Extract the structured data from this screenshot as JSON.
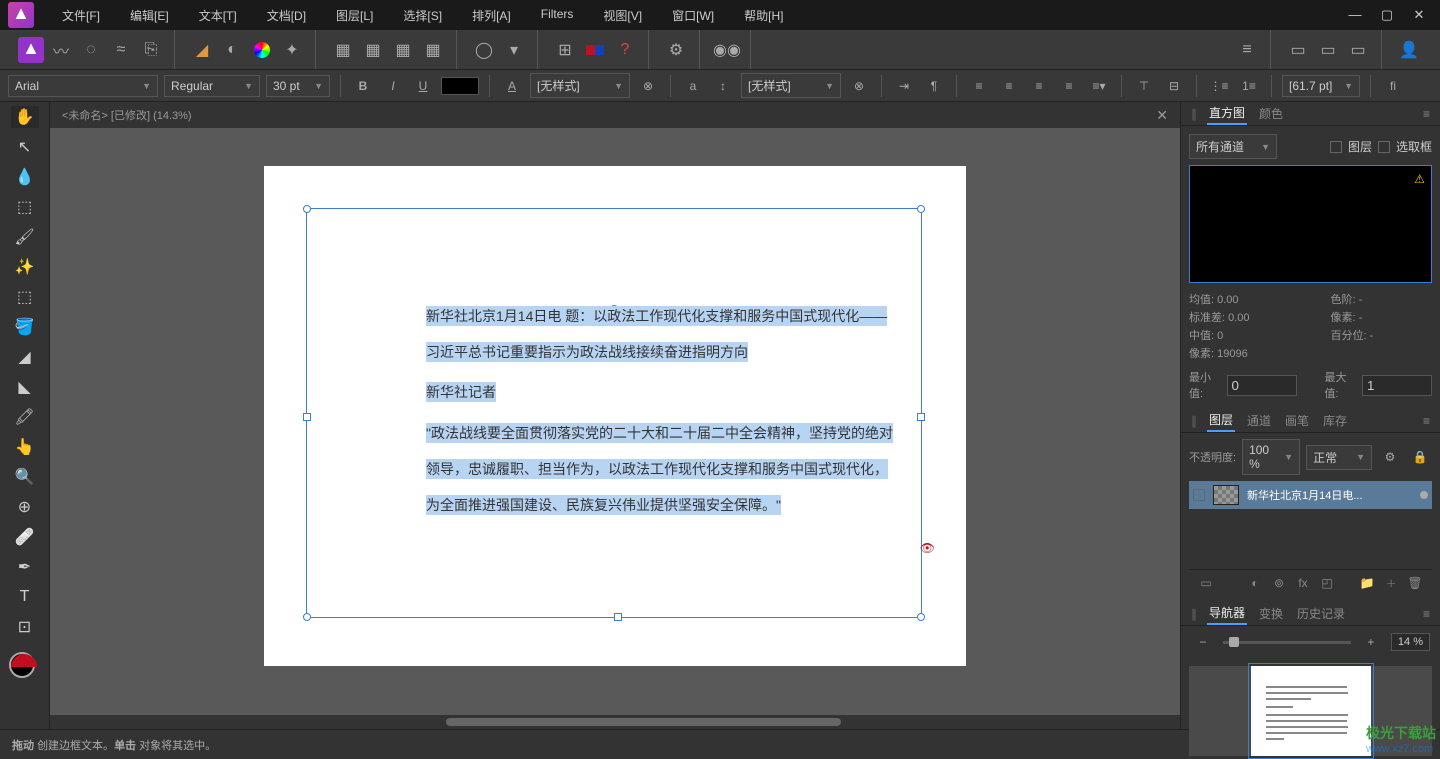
{
  "titlebar": {
    "menu": [
      "文件[F]",
      "编辑[E]",
      "文本[T]",
      "文档[D]",
      "图层[L]",
      "选择[S]",
      "排列[A]",
      "Filters",
      "视图[V]",
      "窗口[W]",
      "帮助[H]"
    ]
  },
  "textbar": {
    "font": "Arial",
    "weight": "Regular",
    "size": "30 pt",
    "char_style_label": "[无样式]",
    "para_style_label": "[无样式]",
    "leading": "[61.7 pt]"
  },
  "tab": {
    "title": "<未命名> [已修改] (14.3%)"
  },
  "document": {
    "p1": "新华社北京1月14日电  题：以政法工作现代化支撑和服务中国式现代化——习近平总书记重要指示为政法战线接续奋进指明方向",
    "p2": "新华社记者",
    "p3": "\"政法战线要全面贯彻落实党的二十大和二十届二中全会精神，坚持党的绝对领导，忠诚履职、担当作为，以政法工作现代化支撑和服务中国式现代化，为全面推进强国建设、民族复兴伟业提供坚强安全保障。\""
  },
  "panels": {
    "histogram": {
      "tab1": "直方图",
      "tab2": "颜色",
      "channel": "所有通道",
      "cb_layer": "图层",
      "cb_sel": "选取框",
      "mean_l": "均值:",
      "mean_v": "0.00",
      "sd_l": "标准差:",
      "sd_v": "0.00",
      "med_l": "中值:",
      "med_v": "0",
      "px_l": "像素:",
      "px_v": "19096",
      "lvl_l": "色阶:",
      "lvl_v": "-",
      "pxs_l": "像素:",
      "pxs_v": "-",
      "pct_l": "百分位:",
      "pct_v": "-",
      "min_l": "最小值:",
      "min_v": "0",
      "max_l": "最大值:",
      "max_v": "1"
    },
    "layers": {
      "tab1": "图层",
      "tab2": "通道",
      "tab3": "画笔",
      "tab4": "库存",
      "opacity_l": "不透明度:",
      "opacity_v": "100 %",
      "blend": "正常",
      "layer_name": "新华社北京1月14日电..."
    },
    "nav": {
      "tab1": "导航器",
      "tab2": "变换",
      "tab3": "历史记录",
      "zoom": "14 %"
    }
  },
  "status": {
    "drag": "拖动",
    "drag_desc": "创建边框文本。",
    "click": "单击",
    "click_desc": "对象将其选中。"
  },
  "watermark": {
    "line1": "极光下载站",
    "line2": "www.xz7.com"
  }
}
